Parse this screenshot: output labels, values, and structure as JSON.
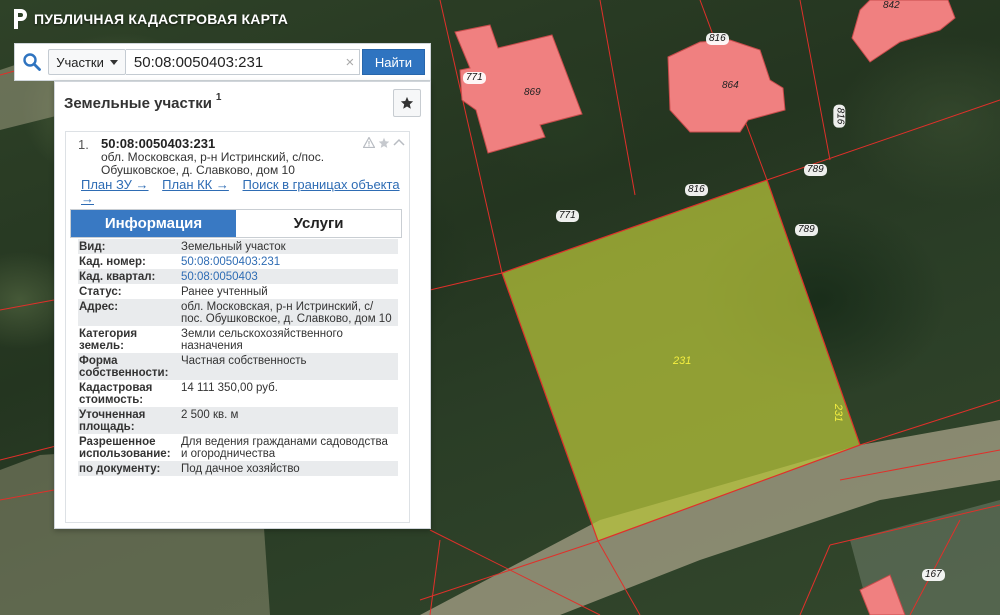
{
  "app": {
    "title": "ПУБЛИЧНАЯ КАДАСТРОВАЯ КАРТА"
  },
  "search": {
    "type_label": "Участки",
    "value": "50:08:0050403:231",
    "clear_symbol": "×",
    "button_label": "Найти"
  },
  "panel": {
    "title": "Земельные участки",
    "count": "1"
  },
  "result": {
    "number": "1.",
    "cadastral_number": "50:08:0050403:231",
    "address": "обл. Московская, р-н Истринский, с/пос. Обушковское, д. Славково, дом 10",
    "links": {
      "plan_zu": "План ЗУ →",
      "plan_kk": "План КК →",
      "search_bounds": "Поиск в границах объекта →"
    }
  },
  "tabs": {
    "info": "Информация",
    "services": "Услуги"
  },
  "details": [
    {
      "key": "Вид:",
      "value": "Земельный участок"
    },
    {
      "key": "Кад. номер:",
      "value": "50:08:0050403:231",
      "link": true
    },
    {
      "key": "Кад. квартал:",
      "value": "50:08:0050403",
      "link": true
    },
    {
      "key": "Статус:",
      "value": "Ранее учтенный"
    },
    {
      "key": "Адрес:",
      "value": "обл. Московская, р-н Истринский, с/пос. Обушковское, д. Славково, дом 10"
    },
    {
      "key": "Категория земель:",
      "value": "Земли сельскохозяйственного назначения"
    },
    {
      "key": "Форма собственности:",
      "value": "Частная собственность"
    },
    {
      "key": "Кадастровая стоимость:",
      "value": "14 111 350,00 руб."
    },
    {
      "key": "Уточненная площадь:",
      "value": "2 500 кв. м"
    },
    {
      "key": "Разрешенное использование:",
      "value": "Для ведения гражданами садоводства и огородничества"
    },
    {
      "key": "по документу:",
      "value": "Под дачное хозяйство"
    }
  ],
  "map_labels": {
    "l771a": "771",
    "l869": "869",
    "l816a": "816",
    "l864": "864",
    "l842": "842",
    "l816v": "816",
    "l789a": "789",
    "l816b": "816",
    "l771b": "771",
    "l789b": "789",
    "l231": "231",
    "l231v": "231",
    "l167": "167"
  },
  "colors": {
    "parcel_fill": "#b9c53a",
    "building_fill": "#f08080",
    "boundary": "#e0302a",
    "button_blue": "#2f74c0",
    "tab_active": "#3979c3"
  }
}
